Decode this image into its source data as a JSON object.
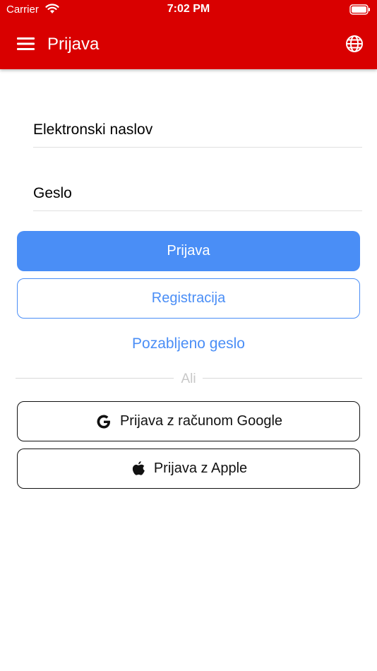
{
  "status_bar": {
    "carrier": "Carrier",
    "time": "7:02 PM"
  },
  "header": {
    "title": "Prijava",
    "background_color": "#d90000"
  },
  "form": {
    "email_placeholder": "Elektronski naslov",
    "password_placeholder": "Geslo"
  },
  "buttons": {
    "login_label": "Prijava",
    "register_label": "Registracija",
    "forgot_password_label": "Pozabljeno geslo",
    "divider_label": "Ali",
    "google_label": "Prijava z računom Google",
    "apple_label": "Prijava z Apple"
  },
  "colors": {
    "accent": "#4a8ef6",
    "header": "#d90000"
  },
  "icons": {
    "status": [
      "wifi-icon",
      "battery-icon"
    ],
    "header": [
      "menu-icon",
      "globe-icon"
    ],
    "social": [
      "google-icon",
      "apple-icon"
    ]
  }
}
